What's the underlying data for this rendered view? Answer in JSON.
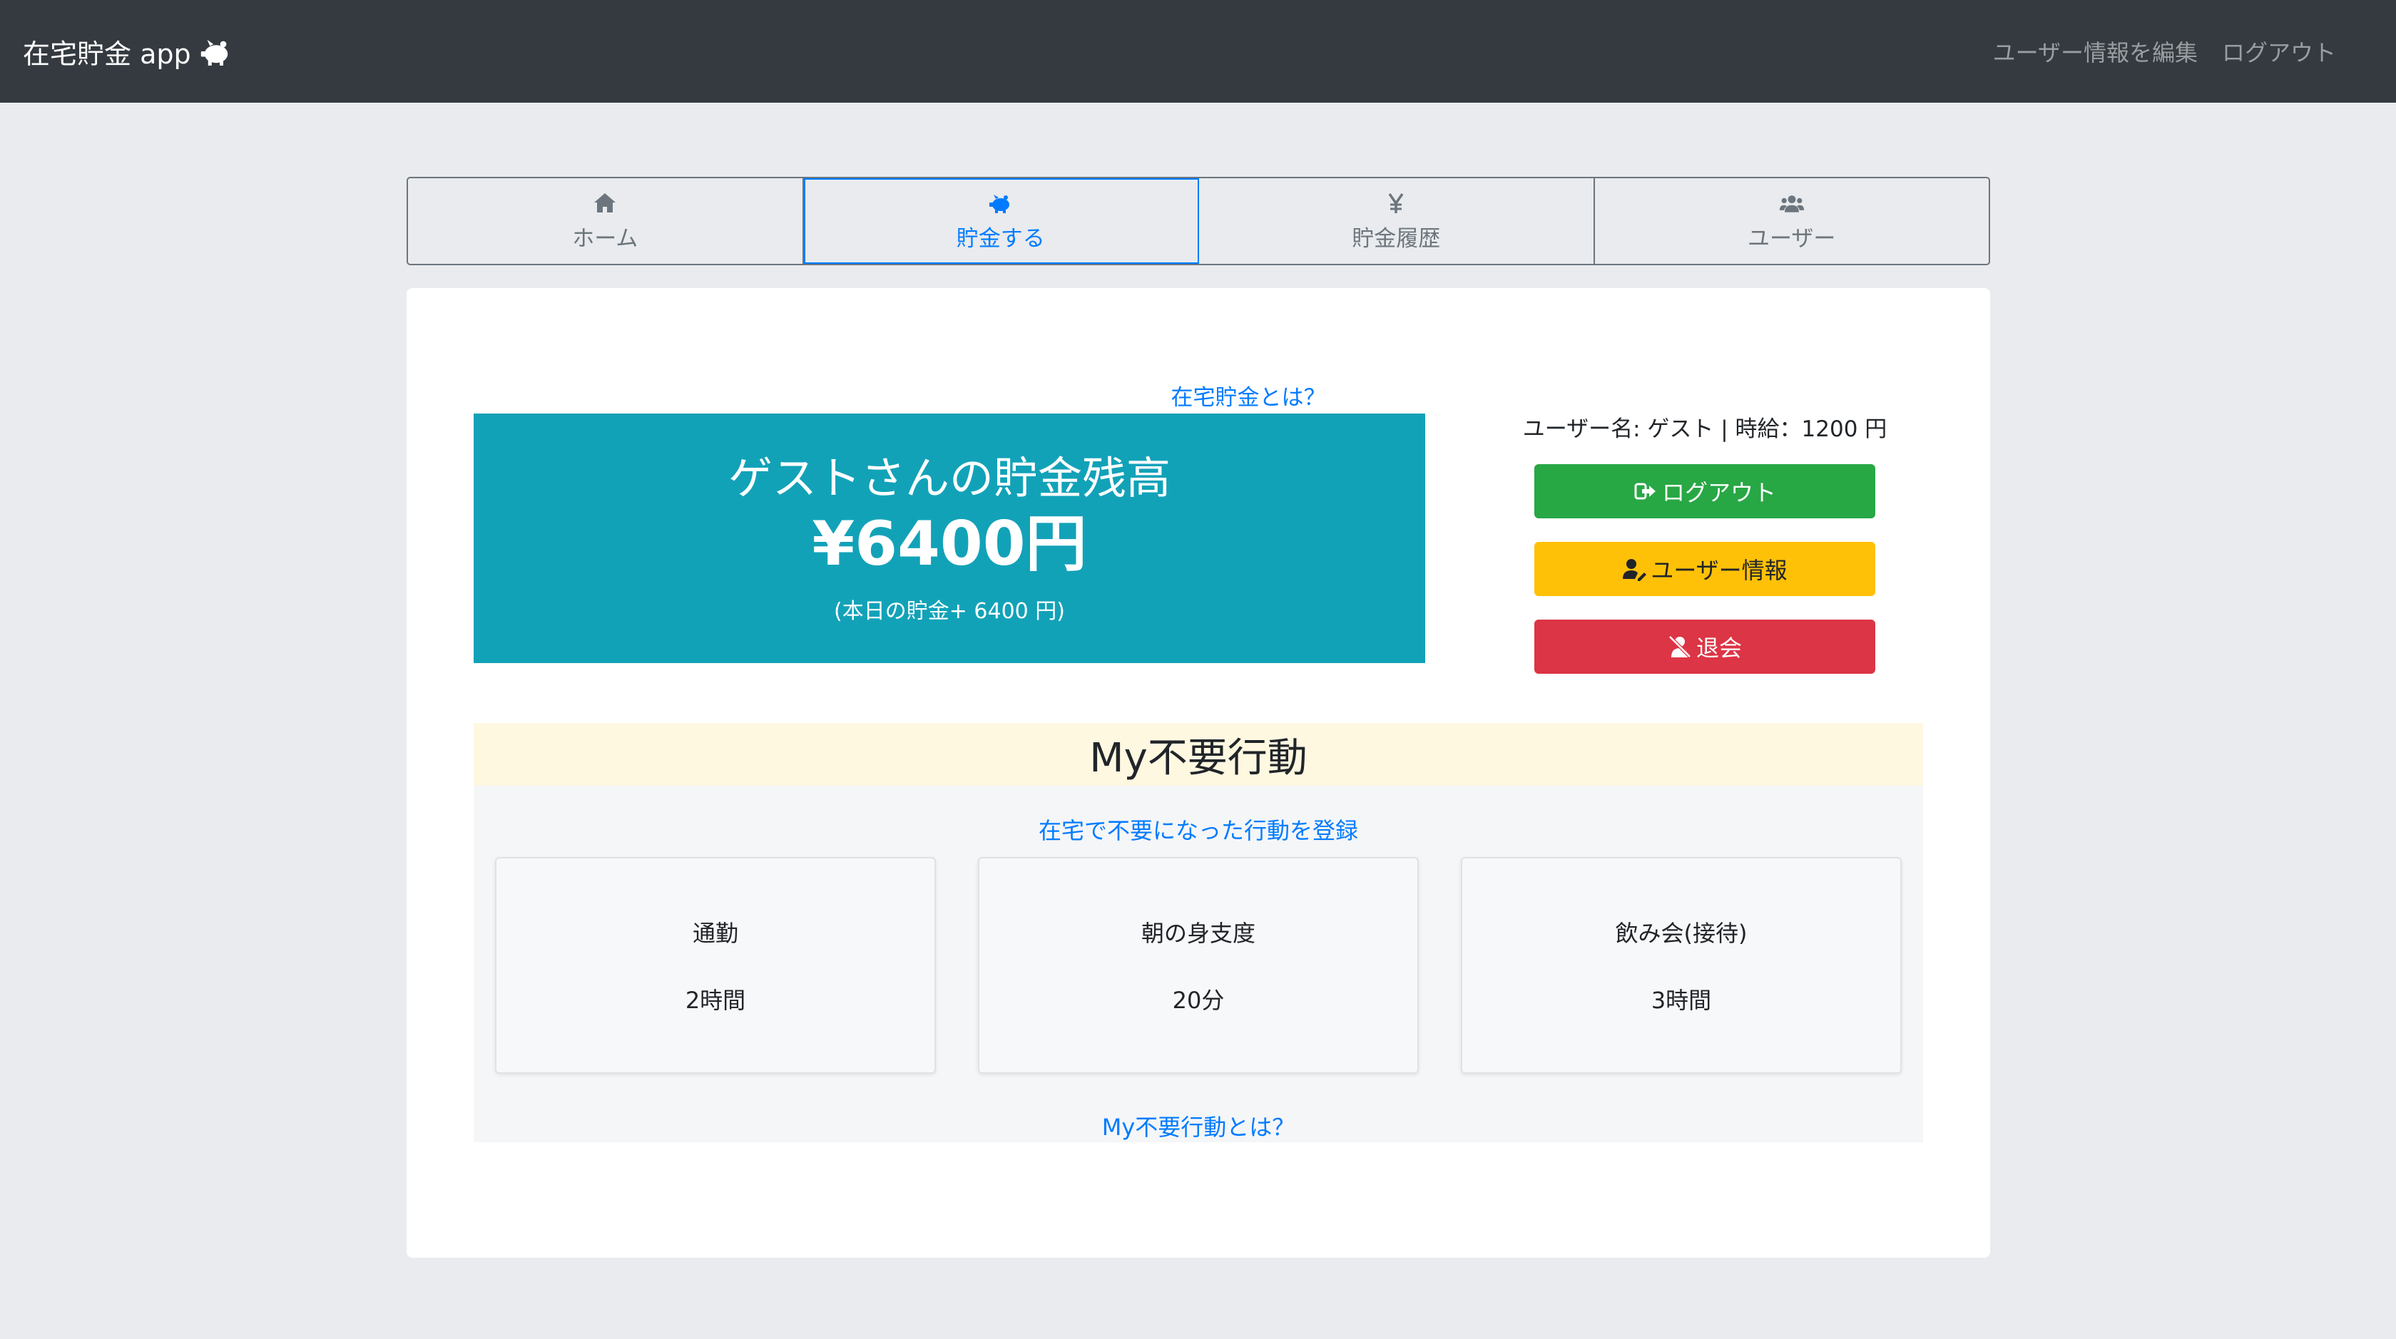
{
  "navbar": {
    "brand": "在宅貯金 app",
    "brand_icon": "piggy-bank-icon",
    "links": [
      "ユーザー情報を編集",
      "ログアウト"
    ]
  },
  "tabs": [
    {
      "label": "ホーム",
      "icon": "home-icon",
      "active": false
    },
    {
      "label": "貯金する",
      "icon": "piggy-bank-icon",
      "active": true
    },
    {
      "label": "貯金履歴",
      "icon": "yen-icon",
      "active": false
    },
    {
      "label": "ユーザー",
      "icon": "users-icon",
      "active": false
    }
  ],
  "main": {
    "about_link": "在宅貯金とは？",
    "balance": {
      "title": "ゲストさんの貯金残高",
      "amount": "¥6400円",
      "today": "(本日の貯金+ 6400 円)"
    },
    "user_info": "ユーザー名: ゲスト | 時給：1200 円",
    "buttons": {
      "logout": "ログアウト",
      "user_info": "ユーザー情報",
      "withdraw": "退会"
    }
  },
  "actions": {
    "title": "My不要行動",
    "register_link": "在宅で不要になった行動を登録",
    "items": [
      {
        "name": "通勤",
        "time": "2時間"
      },
      {
        "name": "朝の身支度",
        "time": "20分"
      },
      {
        "name": "飲み会(接待)",
        "time": "3時間"
      }
    ],
    "what_link": "My不要行動とは？"
  },
  "colors": {
    "navbar": "#343a40",
    "page_bg": "#e9ebee",
    "balance_bg": "#12a2b8",
    "success": "#28a745",
    "warning": "#ffc107",
    "danger": "#dc3545",
    "link": "#007bff",
    "actions_header_bg": "#fff8e1"
  }
}
